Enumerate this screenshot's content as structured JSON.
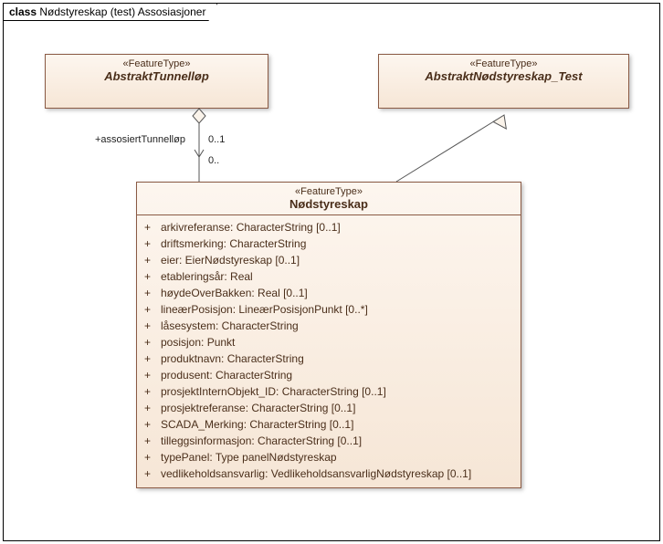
{
  "frame": {
    "keyword": "class",
    "title": "Nødstyreskap (test) Assosiasjoner"
  },
  "classes": {
    "abstraktTunnellop": {
      "stereotype": "«FeatureType»",
      "name": "AbstraktTunnelløp"
    },
    "abstraktNodstyreskapTest": {
      "stereotype": "«FeatureType»",
      "name": "AbstraktNødstyreskap_Test"
    },
    "nodstyreskap": {
      "stereotype": "«FeatureType»",
      "name": "Nødstyreskap",
      "attributes": [
        {
          "vis": "+",
          "sig": "arkivreferanse: CharacterString [0..1]"
        },
        {
          "vis": "+",
          "sig": "driftsmerking: CharacterString"
        },
        {
          "vis": "+",
          "sig": "eier: EierNødstyreskap [0..1]"
        },
        {
          "vis": "+",
          "sig": "etableringsår: Real"
        },
        {
          "vis": "+",
          "sig": "høydeOverBakken: Real [0..1]"
        },
        {
          "vis": "+",
          "sig": "lineærPosisjon: LineærPosisjonPunkt [0..*]"
        },
        {
          "vis": "+",
          "sig": "låsesystem: CharacterString"
        },
        {
          "vis": "+",
          "sig": "posisjon: Punkt"
        },
        {
          "vis": "+",
          "sig": "produktnavn: CharacterString"
        },
        {
          "vis": "+",
          "sig": "produsent: CharacterString"
        },
        {
          "vis": "+",
          "sig": "prosjektInternObjekt_ID: CharacterString [0..1]"
        },
        {
          "vis": "+",
          "sig": "prosjektreferanse: CharacterString [0..1]"
        },
        {
          "vis": "+",
          "sig": "SCADA_Merking: CharacterString [0..1]"
        },
        {
          "vis": "+",
          "sig": "tilleggsinformasjon: CharacterString [0..1]"
        },
        {
          "vis": "+",
          "sig": "typePanel: Type panelNødstyreskap"
        },
        {
          "vis": "+",
          "sig": "vedlikeholdsansvarlig: VedlikeholdsansvarligNødstyreskap [0..1]"
        }
      ]
    }
  },
  "connectors": {
    "assocRole": "+assosiertTunnelløp",
    "multUpper": "0..1",
    "multLower": "0.."
  }
}
